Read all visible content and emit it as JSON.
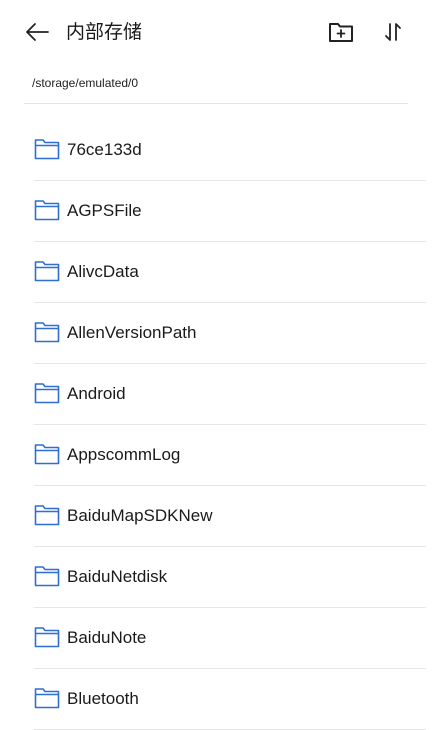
{
  "header": {
    "back_icon": "arrow-left-icon",
    "title": "内部存储",
    "new_folder_icon": "folder-plus-icon",
    "sort_icon": "sort-arrows-icon"
  },
  "path": "/storage/emulated/0",
  "folder_icon": "folder-outline-icon",
  "folder_color": "#2f6fd1",
  "folders": [
    {
      "name": "76ce133d"
    },
    {
      "name": "AGPSFile"
    },
    {
      "name": "AlivcData"
    },
    {
      "name": "AllenVersionPath"
    },
    {
      "name": "Android"
    },
    {
      "name": "AppscommLog"
    },
    {
      "name": "BaiduMapSDKNew"
    },
    {
      "name": "BaiduNetdisk"
    },
    {
      "name": "BaiduNote"
    },
    {
      "name": "Bluetooth"
    }
  ]
}
